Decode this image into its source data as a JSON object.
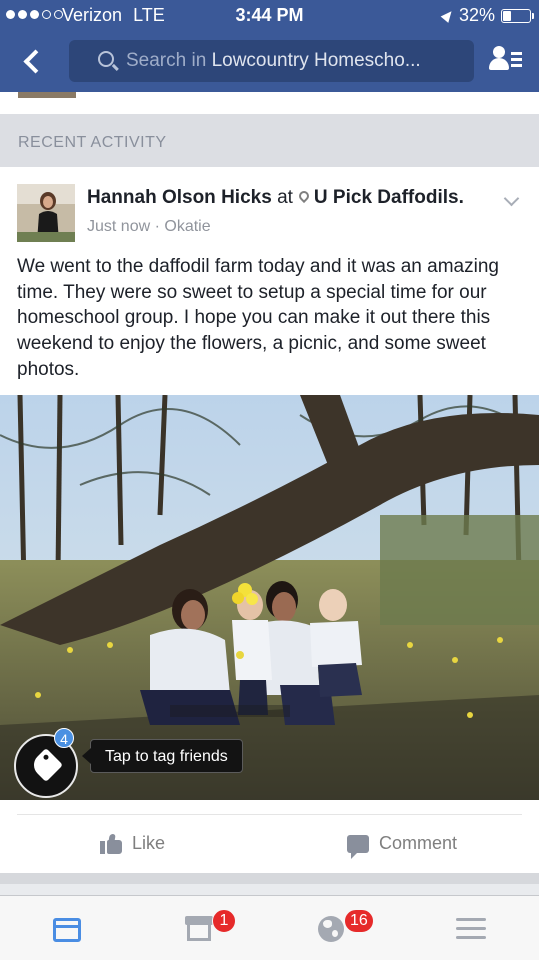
{
  "status_bar": {
    "carrier": "Verizon",
    "network": "LTE",
    "time": "3:44 PM",
    "battery": "32%",
    "battery_level": 0.32,
    "signal_bars_filled": 3,
    "signal_bars_total": 5
  },
  "header": {
    "search_placeholder": "Search in",
    "search_value": "Lowcountry Homescho..."
  },
  "section": {
    "title": "RECENT ACTIVITY"
  },
  "post": {
    "author": "Hannah Olson Hicks",
    "connector": "at",
    "place": "U Pick Daffodils.",
    "time": "Just now",
    "separator": "·",
    "location": "Okatie",
    "text": "We went to the daffodil farm today and it was an amazing time. They were so sweet to setup a special time for our homeschool group. I hope you can make it out there this weekend to enjoy the flowers, a picnic, and some sweet photos.",
    "tag_count": "4",
    "tag_prompt": "Tap to tag friends",
    "like_label": "Like",
    "comment_label": "Comment"
  },
  "tabbar": {
    "marketplace_badge": "1",
    "notifications_badge": "16"
  },
  "colors": {
    "brand_blue": "#3b5998",
    "tab_active": "#4a8de3",
    "badge_red": "#e62a2a"
  }
}
